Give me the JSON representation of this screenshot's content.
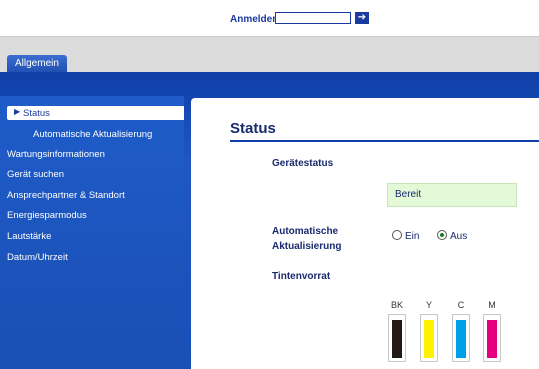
{
  "login": {
    "label": "Anmelden",
    "input_value": ""
  },
  "tabs": [
    {
      "label": "Allgemein"
    }
  ],
  "sidebar": {
    "items": [
      {
        "label": "Status",
        "active": true
      },
      {
        "label": "Automatische Aktualisierung"
      },
      {
        "label": "Wartungsinformationen"
      },
      {
        "label": "Gerät suchen"
      },
      {
        "label": "Ansprechpartner & Standort"
      },
      {
        "label": "Energiesparmodus"
      },
      {
        "label": "Lautstärke"
      },
      {
        "label": "Datum/Uhrzeit"
      }
    ]
  },
  "main": {
    "title": "Status",
    "device_status_label": "Gerätestatus",
    "device_status_value": "Bereit",
    "auto_update_label_line1": "Automatische",
    "auto_update_label_line2": "Aktualisierung",
    "auto_update_options": [
      {
        "label": "Ein",
        "selected": false
      },
      {
        "label": "Aus",
        "selected": true
      }
    ],
    "ink_label": "Tintenvorrat",
    "inks": [
      {
        "name": "BK",
        "color": "#231815"
      },
      {
        "name": "Y",
        "color": "#fff200"
      },
      {
        "name": "C",
        "color": "#00a0e9"
      },
      {
        "name": "M",
        "color": "#e4007f"
      }
    ]
  },
  "colors": {
    "accent_blue": "#0f3fa8",
    "text_navy": "#1a2a6e"
  }
}
